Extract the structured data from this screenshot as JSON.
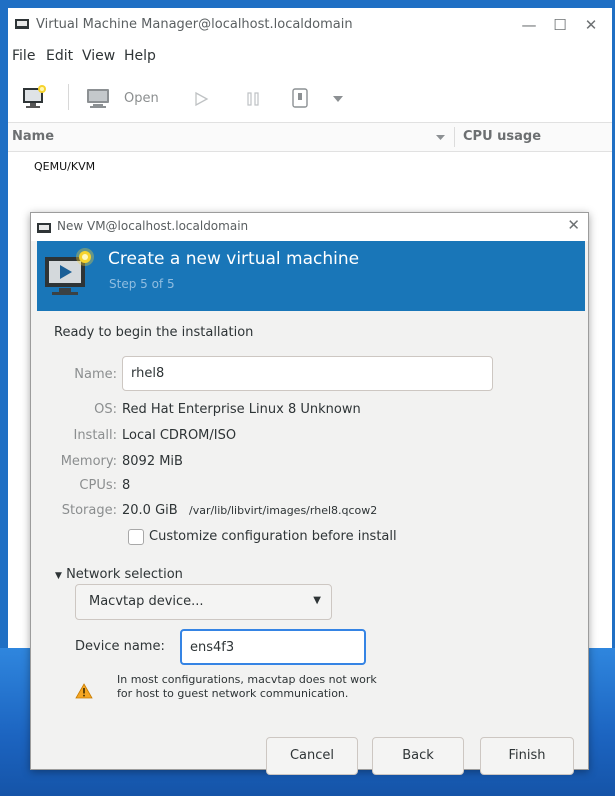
{
  "main_window": {
    "title": "Virtual Machine Manager@localhost.localdomain",
    "controls": {
      "minimize": "—",
      "maximize": "☐",
      "close": "✕"
    },
    "menu": [
      "File",
      "Edit",
      "View",
      "Help"
    ],
    "toolbar": {
      "open_label": "Open",
      "icons": [
        "new-vm-icon",
        "monitor-icon",
        "play-icon",
        "pause-icon",
        "shutdown-icon",
        "dropdown-arrow-icon"
      ]
    },
    "columns": {
      "name": "Name",
      "cpu": "CPU usage"
    },
    "connections": [
      "QEMU/KVM"
    ]
  },
  "dialog": {
    "title": "New VM@localhost.localdomain",
    "close": "✕",
    "heading": "Create a new virtual machine",
    "step": "Step 5 of 5",
    "ready_text": "Ready to begin the installation",
    "name_label": "Name:",
    "name_value": "rhel8",
    "os_label": "OS:",
    "os_value": "Red Hat Enterprise Linux 8 Unknown",
    "install_label": "Install:",
    "install_value": "Local CDROM/ISO",
    "memory_label": "Memory:",
    "memory_value": "8092 MiB",
    "cpus_label": "CPUs:",
    "cpus_value": "8",
    "storage_label": "Storage:",
    "storage_value": "20.0 GiB",
    "storage_path": "/var/lib/libvirt/images/rhel8.qcow2",
    "customize_label": "Customize configuration before install",
    "customize_checked": false,
    "network_expander": "Network selection",
    "network_selected": "Macvtap device...",
    "device_name_label": "Device name:",
    "device_name_value": "ens4f3",
    "warning": "In most configurations, macvtap does not work for host to guest network communication.",
    "buttons": {
      "cancel": "Cancel",
      "back": "Back",
      "finish": "Finish"
    }
  },
  "colors": {
    "banner": "#1976b8",
    "desktop": "#1f6fc4",
    "focus": "#3584e4",
    "warning": "#f5a623"
  }
}
